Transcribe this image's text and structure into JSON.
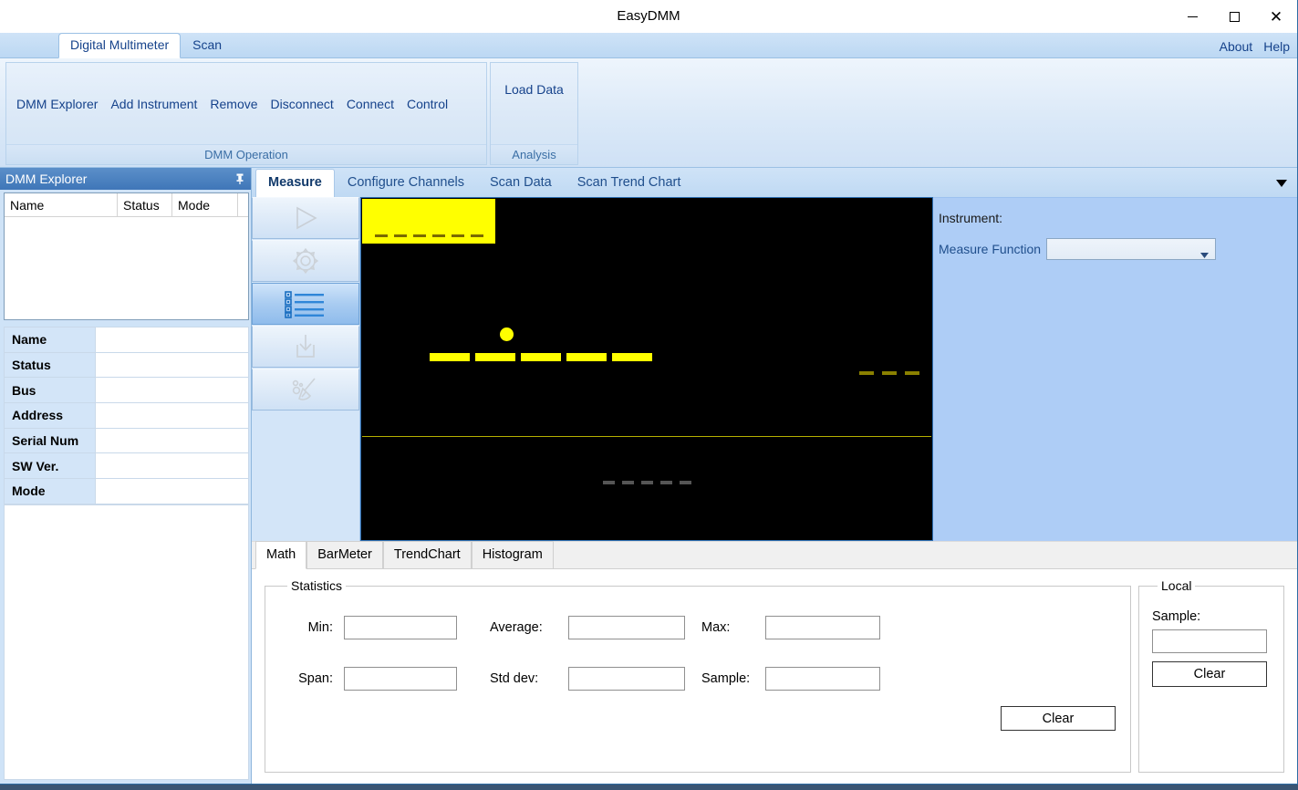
{
  "window": {
    "title": "EasyDMM",
    "controls": [
      {
        "name": "minimize",
        "glyph": "minimize-icon"
      },
      {
        "name": "maximize",
        "glyph": "maximize-icon"
      },
      {
        "name": "close",
        "glyph": "close-icon",
        "label": "✕"
      }
    ]
  },
  "ribbon": {
    "tabs": [
      {
        "label": "Digital Multimeter",
        "active": true
      },
      {
        "label": "Scan",
        "active": false
      }
    ],
    "links": [
      {
        "label": "About"
      },
      {
        "label": "Help"
      }
    ],
    "groups": [
      {
        "label": "DMM Operation",
        "buttons": [
          {
            "label": "DMM Explorer"
          },
          {
            "label": "Add Instrument"
          },
          {
            "label": "Remove"
          },
          {
            "label": "Disconnect"
          },
          {
            "label": "Connect"
          },
          {
            "label": "Control"
          }
        ]
      },
      {
        "label": "Analysis",
        "buttons": [
          {
            "label": "Load Data"
          }
        ]
      }
    ]
  },
  "sidebar": {
    "title": "DMM Explorer",
    "pin_icon": "pushpin-icon",
    "grid": {
      "columns": [
        "Name",
        "Status",
        "Mode"
      ],
      "rows": []
    },
    "properties": [
      {
        "key": "Name",
        "value": ""
      },
      {
        "key": "Status",
        "value": ""
      },
      {
        "key": "Bus",
        "value": ""
      },
      {
        "key": "Address",
        "value": ""
      },
      {
        "key": "Serial Num",
        "value": ""
      },
      {
        "key": "SW Ver.",
        "value": ""
      },
      {
        "key": "Mode",
        "value": ""
      }
    ]
  },
  "main": {
    "tabs": [
      {
        "label": "Measure",
        "active": true
      },
      {
        "label": "Configure Channels",
        "active": false
      },
      {
        "label": "Scan Data",
        "active": false
      },
      {
        "label": "Scan Trend Chart",
        "active": false
      }
    ],
    "collapse_icon": "chevron-down-icon",
    "toolbar": [
      {
        "name": "run-button",
        "icon": "play-icon",
        "active": false,
        "enabled": false
      },
      {
        "name": "settings-button",
        "icon": "gear-icon",
        "active": false,
        "enabled": false
      },
      {
        "name": "channel-list-button",
        "icon": "list-icon",
        "active": true,
        "enabled": true
      },
      {
        "name": "save-data-button",
        "icon": "save-download-icon",
        "active": false,
        "enabled": false
      },
      {
        "name": "clear-display-button",
        "icon": "broom-icon",
        "active": false,
        "enabled": false
      }
    ],
    "display": {
      "secondary_value": "------",
      "secondary_segments": 6,
      "main_value": "-----",
      "main_segments": 5,
      "decimal_point": true,
      "unit_value": "---",
      "unit_segments": 3,
      "bottom_value": "-----",
      "bottom_segments": 5,
      "colors": {
        "background": "#000000",
        "active_segment": "#ffff00",
        "dim_segment": "#8a8000",
        "inactive_segment": "#555555",
        "highlight_block": "#ffff00",
        "divider": "#b5b000"
      }
    },
    "instrument": {
      "label": "Instrument:",
      "measure_function_label": "Measure Function",
      "measure_function_value": "",
      "dropdown_icon": "chevron-down-icon"
    }
  },
  "bottom": {
    "tabs": [
      {
        "label": "Math",
        "active": true
      },
      {
        "label": "BarMeter",
        "active": false
      },
      {
        "label": "TrendChart",
        "active": false
      },
      {
        "label": "Histogram",
        "active": false
      }
    ],
    "statistics": {
      "legend": "Statistics",
      "fields": [
        {
          "label": "Min:",
          "value": ""
        },
        {
          "label": "Average:",
          "value": ""
        },
        {
          "label": "Max:",
          "value": ""
        },
        {
          "label": "Span:",
          "value": ""
        },
        {
          "label": "Std dev:",
          "value": ""
        },
        {
          "label": "Sample:",
          "value": ""
        }
      ],
      "clear_label": "Clear"
    },
    "local": {
      "legend": "Local",
      "sample_label": "Sample:",
      "sample_value": "",
      "clear_label": "Clear"
    }
  }
}
